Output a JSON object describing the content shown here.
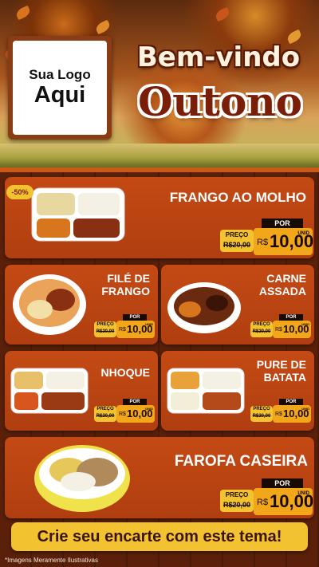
{
  "hero": {
    "logo_line1": "Sua Logo",
    "logo_line2": "Aqui",
    "welcome": "Bem-vindo",
    "season": "Outono"
  },
  "items": [
    {
      "name": "FRANGO AO MOLHO",
      "badge": "-50%",
      "por": "POR",
      "preco_label": "PREÇO",
      "old_price": "R$20,00",
      "currency": "R$",
      "price": "10,00",
      "unit": "UNID"
    },
    {
      "name_line1": "FILÉ DE",
      "name_line2": "FRANGO",
      "por": "POR",
      "preco_label": "PREÇO",
      "old_price": "R$20,00",
      "currency": "R$",
      "price": "10,00",
      "unit": "UNID"
    },
    {
      "name_line1": "CARNE",
      "name_line2": "ASSADA",
      "por": "POR",
      "preco_label": "PREÇO",
      "old_price": "R$20,00",
      "currency": "R$",
      "price": "10,00",
      "unit": "UNID"
    },
    {
      "name": "NHOQUE",
      "por": "POR",
      "preco_label": "PREÇO",
      "old_price": "R$20,00",
      "currency": "R$",
      "price": "10,00",
      "unit": "UNID"
    },
    {
      "name_line1": "PURE DE",
      "name_line2": "BATATA",
      "por": "POR",
      "preco_label": "PREÇO",
      "old_price": "R$20,00",
      "currency": "R$",
      "price": "10,00",
      "unit": "UNID"
    },
    {
      "name": "FAROFA CASEIRA",
      "por": "POR",
      "preco_label": "PREÇO",
      "old_price": "R$20,00",
      "currency": "R$",
      "price": "10,00",
      "unit": "UNID"
    }
  ],
  "cta": "Crie seu encarte com este tema!",
  "footer": "*Imagens Meramente Ilustrativas",
  "colors": {
    "card": "#c44a14",
    "accent": "#f2a61a",
    "yellow": "#f2c230",
    "dark": "#1a0a04"
  }
}
